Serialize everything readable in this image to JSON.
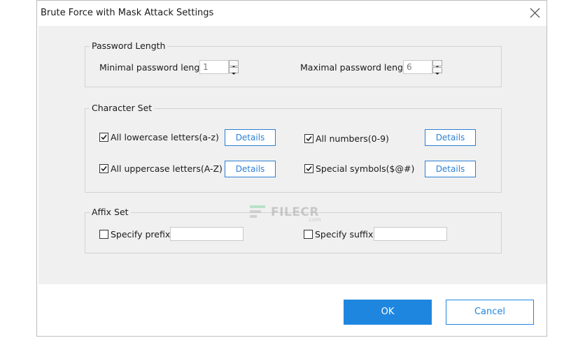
{
  "window": {
    "title": "Brute Force with Mask Attack Settings",
    "close_icon": "close-icon"
  },
  "password_length": {
    "group_title": "Password Length",
    "min_label": "Minimal password length",
    "min_value": "1",
    "max_label": "Maximal password length",
    "max_value": "6"
  },
  "character_set": {
    "group_title": "Character Set",
    "details_label": "Details",
    "options": [
      {
        "label": "All lowercase letters(a-z)",
        "checked": true
      },
      {
        "label": "All numbers(0-9)",
        "checked": true
      },
      {
        "label": "All uppercase letters(A-Z)",
        "checked": true
      },
      {
        "label": "Special symbols($@#)",
        "checked": true
      }
    ]
  },
  "affix_set": {
    "group_title": "Affix Set",
    "prefix_label": "Specify prefix:",
    "prefix_checked": false,
    "prefix_value": "",
    "suffix_label": "Specify suffix:",
    "suffix_checked": false,
    "suffix_value": ""
  },
  "buttons": {
    "ok": "OK",
    "cancel": "Cancel"
  },
  "watermark": {
    "text": "FILECR",
    "sub": ".com"
  },
  "colors": {
    "accent": "#1f86e0",
    "panel_bg": "#f0f0f0",
    "details_border": "#2b7fd4"
  }
}
